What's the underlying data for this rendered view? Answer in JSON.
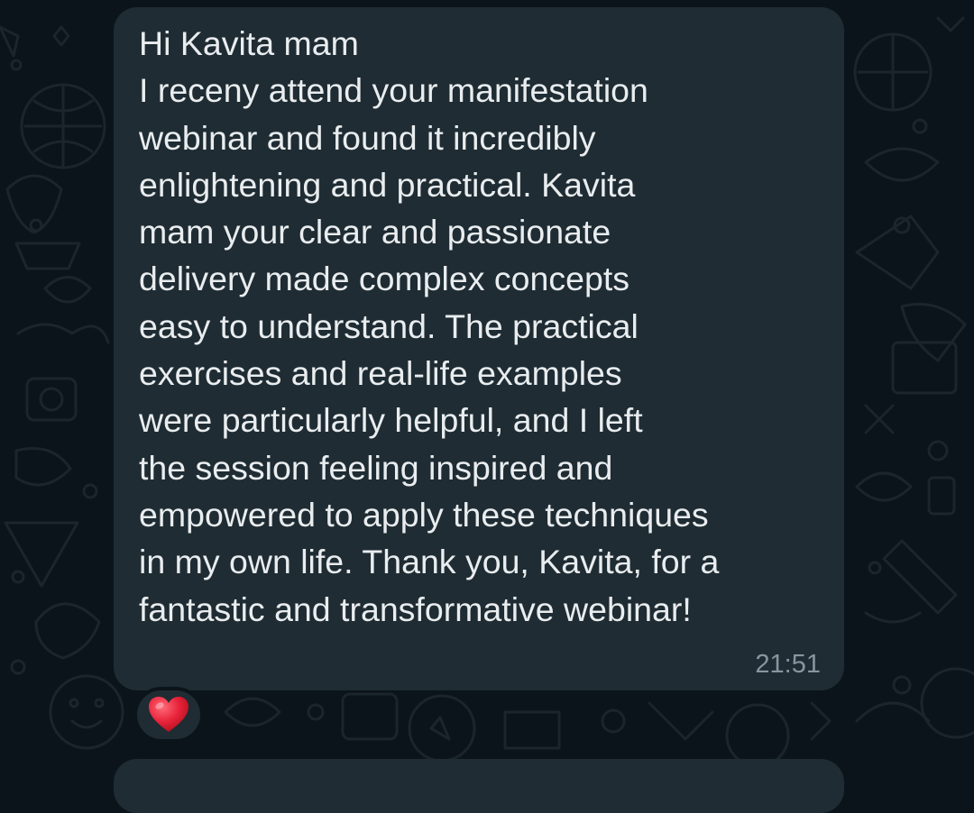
{
  "colors": {
    "background": "#0b141a",
    "bubble": "#1f2c33",
    "text": "#e9edef",
    "timestamp": "#8696a0",
    "reaction": "#e8233a"
  },
  "message": {
    "lines": [
      "Hi Kavita mam",
      "I receny attend your manifestation",
      "webinar and found it incredibly",
      "enlightening and practical. Kavita",
      "mam your  clear and passionate",
      "delivery made complex concepts",
      "easy to understand. The practical",
      "exercises and real-life examples",
      "were particularly helpful, and I left",
      "the session feeling inspired and",
      "empowered to apply these techniques",
      "in my own life. Thank you, Kavita, for a",
      "fantastic and transformative webinar!"
    ],
    "time": "21:51"
  },
  "reaction": {
    "icon": "red-heart-icon"
  }
}
